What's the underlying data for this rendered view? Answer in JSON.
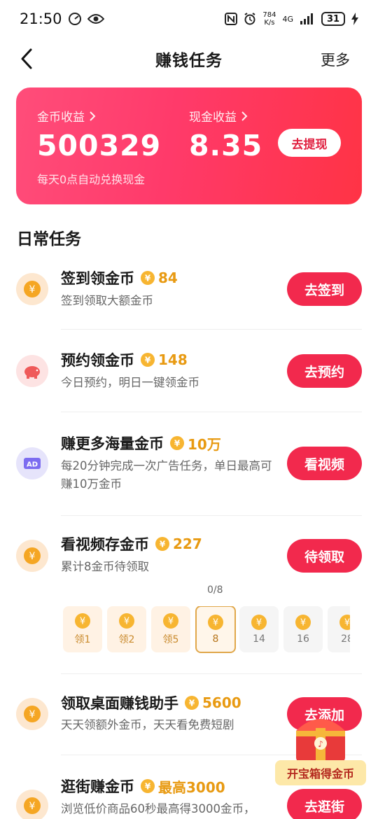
{
  "status_bar": {
    "time": "21:50",
    "net_speed_top": "784",
    "net_speed_bottom": "K/s",
    "network": "4G",
    "battery": "31"
  },
  "header": {
    "title": "赚钱任务",
    "more": "更多"
  },
  "earnings": {
    "coin_label": "金币收益",
    "coin_value": "500329",
    "cash_label": "现金收益",
    "cash_value": "8.35",
    "note": "每天0点自动兑换现金",
    "withdraw": "去提现"
  },
  "section": {
    "title": "日常任务"
  },
  "tasks": [
    {
      "name": "签到领金币",
      "reward": "84",
      "desc": "签到领取大额金币",
      "button": "去签到",
      "icon": "yen-coin-icon"
    },
    {
      "name": "预约领金币",
      "reward": "148",
      "desc": "今日预约，明日一键领金币",
      "button": "去预约",
      "icon": "piggy-bank-icon"
    },
    {
      "name": "赚更多海量金币",
      "reward": "10万",
      "desc": "每20分钟完成一次广告任务，单日最高可赚10万金币",
      "button": "看视频",
      "icon": "ad-icon"
    },
    {
      "name": "看视频存金币",
      "reward": "227",
      "desc": "累计8金币待领取",
      "button": "待领取",
      "icon": "yen-coin-icon"
    },
    {
      "name": "领取桌面赚钱助手",
      "reward": "5600",
      "desc": "天天领额外金币，天天看免费短剧",
      "button": "去添加",
      "icon": "yen-coin-icon"
    },
    {
      "name": "逛街赚金币",
      "reward": "最高3000",
      "desc": "浏览低价商品60秒最高得3000金币，",
      "button": "去逛街",
      "icon": "yen-coin-icon"
    }
  ],
  "video_progress": {
    "label": "0/8",
    "cells": [
      {
        "label": "领1",
        "state": "claimed"
      },
      {
        "label": "领2",
        "state": "claimed"
      },
      {
        "label": "领5",
        "state": "claimed"
      },
      {
        "label": "8",
        "state": "current"
      },
      {
        "label": "14",
        "state": "locked"
      },
      {
        "label": "16",
        "state": "locked"
      },
      {
        "label": "28",
        "state": "locked"
      }
    ]
  },
  "floating": {
    "label": "开宝箱得金币"
  },
  "colors": {
    "accent": "#f2294d",
    "coin_gold": "#e89a12",
    "card_start": "#ff4d7a",
    "card_end": "#ff3345"
  }
}
